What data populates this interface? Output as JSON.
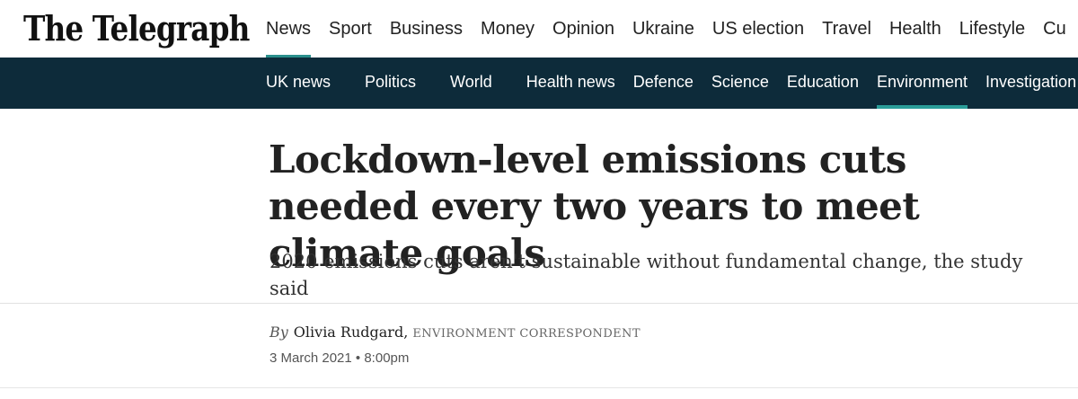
{
  "brand": {
    "name": "The Telegraph"
  },
  "main_nav": {
    "items": [
      {
        "label": "News",
        "active": true
      },
      {
        "label": "Sport"
      },
      {
        "label": "Business"
      },
      {
        "label": "Money"
      },
      {
        "label": "Opinion"
      },
      {
        "label": "Ukraine"
      },
      {
        "label": "US election"
      },
      {
        "label": "Travel"
      },
      {
        "label": "Health"
      },
      {
        "label": "Lifestyle"
      },
      {
        "label": "Cu"
      }
    ]
  },
  "sub_nav": {
    "items": [
      {
        "label": "UK news"
      },
      {
        "label": "Politics"
      },
      {
        "label": "World"
      },
      {
        "label": "Health news"
      },
      {
        "label": "Defence"
      },
      {
        "label": "Science"
      },
      {
        "label": "Education"
      },
      {
        "label": "Environment",
        "active": true
      },
      {
        "label": "Investigation"
      }
    ]
  },
  "article": {
    "headline": "Lockdown-level emissions cuts needed every two years to meet climate goals",
    "standfirst": "2020 emissions cuts aren't sustainable without fundamental change, the study said",
    "byline": {
      "by": "By",
      "author": "Olivia Rudgard",
      "separator": ",",
      "role": "ENVIRONMENT CORRESPONDENT"
    },
    "date": "3 March 2021",
    "time_separator": "•",
    "time": "8:00pm"
  },
  "colors": {
    "subbar_bg": "#0d2b3a",
    "accent": "#2a9d99"
  }
}
